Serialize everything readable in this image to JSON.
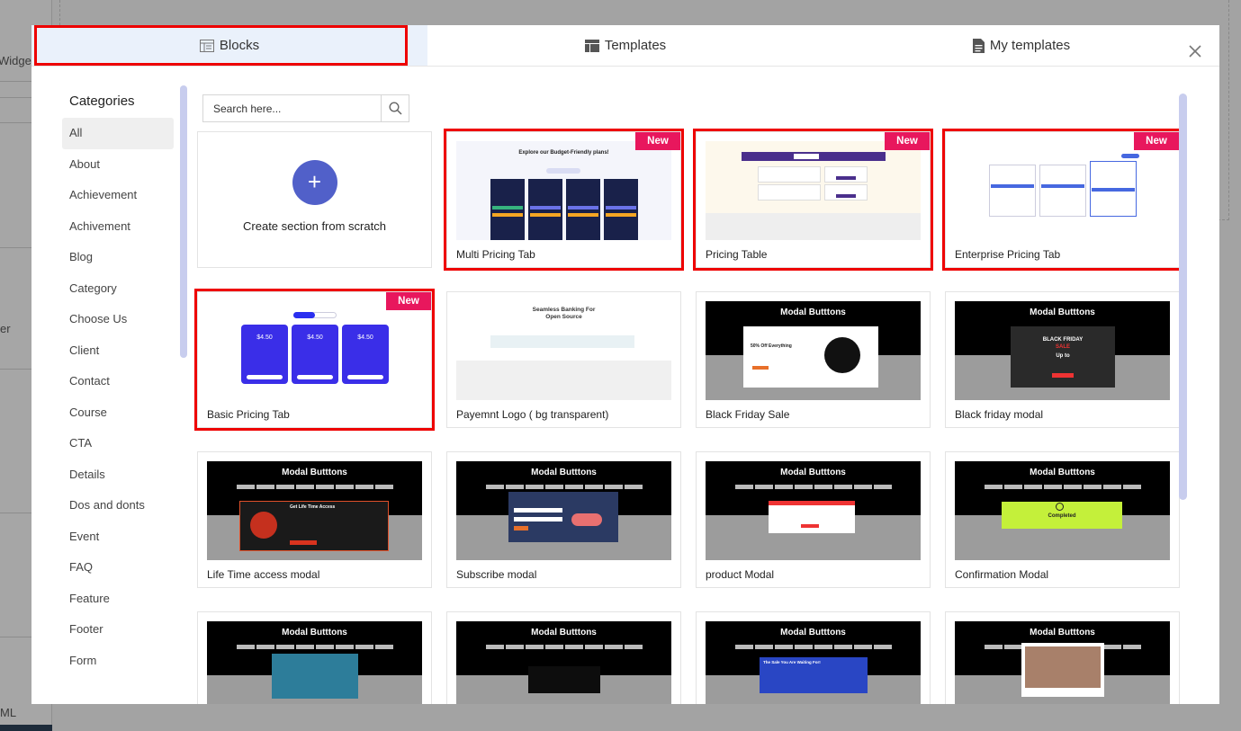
{
  "background": {
    "partial_labels": [
      "Widget",
      "er",
      "ML"
    ]
  },
  "tabs": [
    {
      "label": "Blocks",
      "icon": "blocks-icon"
    },
    {
      "label": "Templates",
      "icon": "templates-icon"
    },
    {
      "label": "My templates",
      "icon": "document-icon"
    }
  ],
  "sidebar": {
    "title": "Categories",
    "items": [
      "All",
      "About",
      "Achievement",
      "Achivement",
      "Blog",
      "Category",
      "Choose Us",
      "Client",
      "Contact",
      "Course",
      "CTA",
      "Details",
      "Dos and donts",
      "Event",
      "FAQ",
      "Feature",
      "Footer",
      "Form"
    ]
  },
  "search": {
    "placeholder": "Search here..."
  },
  "scratch": {
    "label": "Create section from scratch",
    "plus": "+"
  },
  "cards": [
    {
      "label": "Multi Pricing Tab",
      "badge": "New"
    },
    {
      "label": "Pricing Table",
      "badge": "New"
    },
    {
      "label": "Enterprise Pricing Tab",
      "badge": "New"
    },
    {
      "label": "Basic Pricing Tab",
      "badge": "New"
    },
    {
      "label": "Payemnt Logo ( bg transparent)"
    },
    {
      "label": "Black Friday Sale"
    },
    {
      "label": "Black friday modal"
    },
    {
      "label": "Life Time access modal"
    },
    {
      "label": "Subscribe modal"
    },
    {
      "label": "product Modal"
    },
    {
      "label": "Confirmation Modal"
    },
    {
      "label": ""
    },
    {
      "label": ""
    },
    {
      "label": ""
    },
    {
      "label": ""
    }
  ],
  "thumb_text": {
    "multi_heading": "Explore our Budget-Friendly plans!",
    "price_a": "$4.50",
    "banking_title": "Seamless Banking For\nOpen Source",
    "modal_title": "Modal Butttons",
    "bf_sale": "50% Off Everything",
    "bf_big": "BLACK FRIDAY",
    "bf_sale2": "SALE",
    "upto": "Up to",
    "ltm_title": "Get Life Time Access",
    "completed": "Completed",
    "sale_wait": "The Sale You Are Waiting For!"
  },
  "colors": {
    "accent": "#5160c9",
    "badge": "#e8175d",
    "highlight": "#ee0000",
    "active_tab": "#eaf1fb"
  }
}
